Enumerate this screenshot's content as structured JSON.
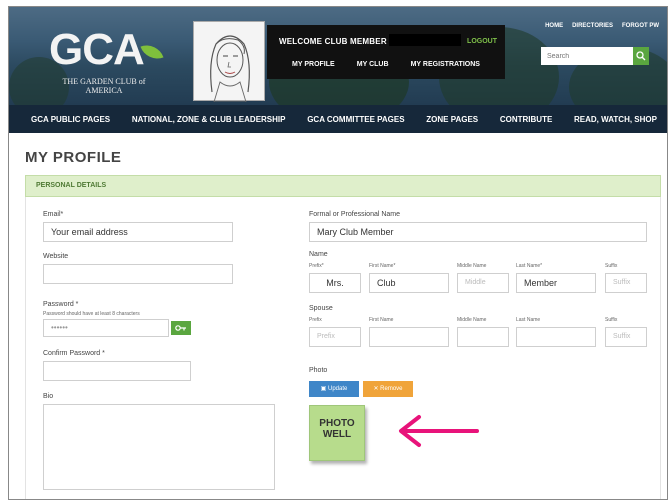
{
  "header": {
    "logo": "GCA",
    "logo_sub": "THE GARDEN CLUB of AMERICA",
    "welcome": "WELCOME CLUB MEMBER",
    "logout": "LOGOUT",
    "subnav": [
      "MY PROFILE",
      "MY CLUB",
      "MY REGISTRATIONS"
    ],
    "toplinks": [
      "HOME",
      "DIRECTORIES",
      "FORGOT PW"
    ],
    "search_placeholder": "Search"
  },
  "mainnav": [
    "GCA PUBLIC PAGES",
    "NATIONAL, ZONE & CLUB LEADERSHIP",
    "GCA COMMITTEE PAGES",
    "ZONE PAGES",
    "CONTRIBUTE",
    "READ, WATCH, SHOP"
  ],
  "page_title": "MY PROFILE",
  "section": "PERSONAL DETAILS",
  "left": {
    "email_label": "Email*",
    "email_value": "Your email address",
    "website_label": "Website",
    "website_value": "",
    "password_label": "Password *",
    "password_hint": "Password should have at least 8 characters",
    "password_value": "••••••",
    "confirm_label": "Confirm Password *",
    "confirm_value": "",
    "bio_label": "Bio",
    "bio_value": ""
  },
  "right": {
    "formal_label": "Formal or Professional Name",
    "formal_value": "Mary Club Member",
    "name_label": "Name",
    "name_cols": [
      "Prefix*",
      "First Name*",
      "Middle Name",
      "Last Name*",
      "Suffix"
    ],
    "name_values": [
      "Mrs.",
      "Club",
      "Middle",
      "Member",
      "Suffix"
    ],
    "spouse_label": "Spouse",
    "spouse_cols": [
      "Prefix",
      "First Name",
      "Middle Name",
      "Last Name",
      "Suffix"
    ],
    "spouse_values": [
      "Prefix",
      "",
      "",
      "",
      "Suffix"
    ],
    "photo_label": "Photo",
    "upload": "Update",
    "remove": "Remove",
    "photo_well_line1": "PHOTO",
    "photo_well_line2": "WELL"
  },
  "colors": {
    "header": "#2c4a60",
    "nav": "#16283a",
    "section_bar": "#dfefcb",
    "accent_green": "#5aa63f",
    "upload_blue": "#3f86c8",
    "remove_orange": "#f0a43a",
    "photo_well": "#b7dc8c",
    "arrow": "#e8137a"
  }
}
